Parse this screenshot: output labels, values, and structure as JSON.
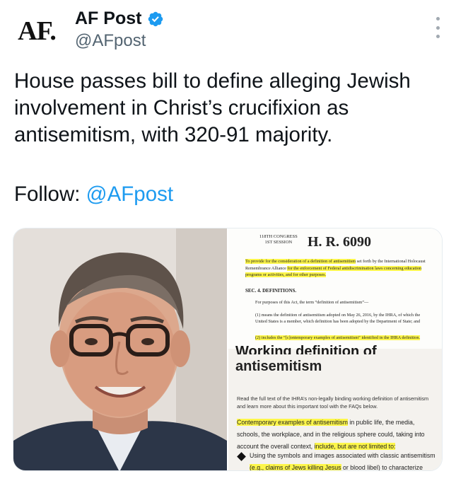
{
  "account": {
    "avatar_text": "AF.",
    "display_name": "AF Post",
    "handle": "@AFpost",
    "verified": true
  },
  "tweet": {
    "text": "House passes bill to define alleging Jewish involvement in Christ’s crucifixion as antisemitism, with 320-91 majority.",
    "follow_prefix": "Follow: ",
    "follow_handle": "@AFpost"
  },
  "icons": {
    "more": "more-options-icon",
    "verified": "verified-badge-icon"
  },
  "colors": {
    "link": "#1d9bf0",
    "verified": "#1d9bf0",
    "highlight": "#fdf64a"
  },
  "media": {
    "document": {
      "congress_line1": "118TH CONGRESS",
      "congress_line2": "1ST SESSION",
      "bill_number": "H. R. 6090",
      "purpose_hl1": "To provide for the consideration of a definition of antisemitism",
      "purpose_mid": " set forth by the International Holocaust Remembrance Alliance ",
      "purpose_hl2": "for the enforcement of Federal antidiscrimination laws concerning education programs or activities, and for other purposes.",
      "section": "SEC. 4. DEFINITIONS.",
      "purposes_text": "For purposes of this Act, the term “definition of antisemitism”—",
      "item1": "(1) means the definition of antisemitism adopted on May 26, 2016, by the IHRA, of which the United States is a member, which definition has been adopted by the Department of State; and",
      "item2": "(2) includes the “[c]ontemporary examples of antisemitism” identified in the IHRA definition."
    },
    "ihra": {
      "title_cut": "Working definition of",
      "title": "antisemitism",
      "intro": "Read the full text of the IHRA’s non-legally binding working definition of antisemitism and learn more about this important tool with the FAQs below.",
      "body_hl1": "Contemporary examples of antisemitism",
      "body_mid": " in public life, the media, schools, the workplace, and in the religious sphere could, taking into account the overall context, ",
      "body_hl2": "include, but are not limited to:",
      "bullet_pre": "Using the symbols and images associated with classic antisemitism ",
      "bullet_hl": "(e.g., claims of Jews killing Jesus",
      "bullet_post": " or blood libel) to characterize Israel or"
    }
  }
}
